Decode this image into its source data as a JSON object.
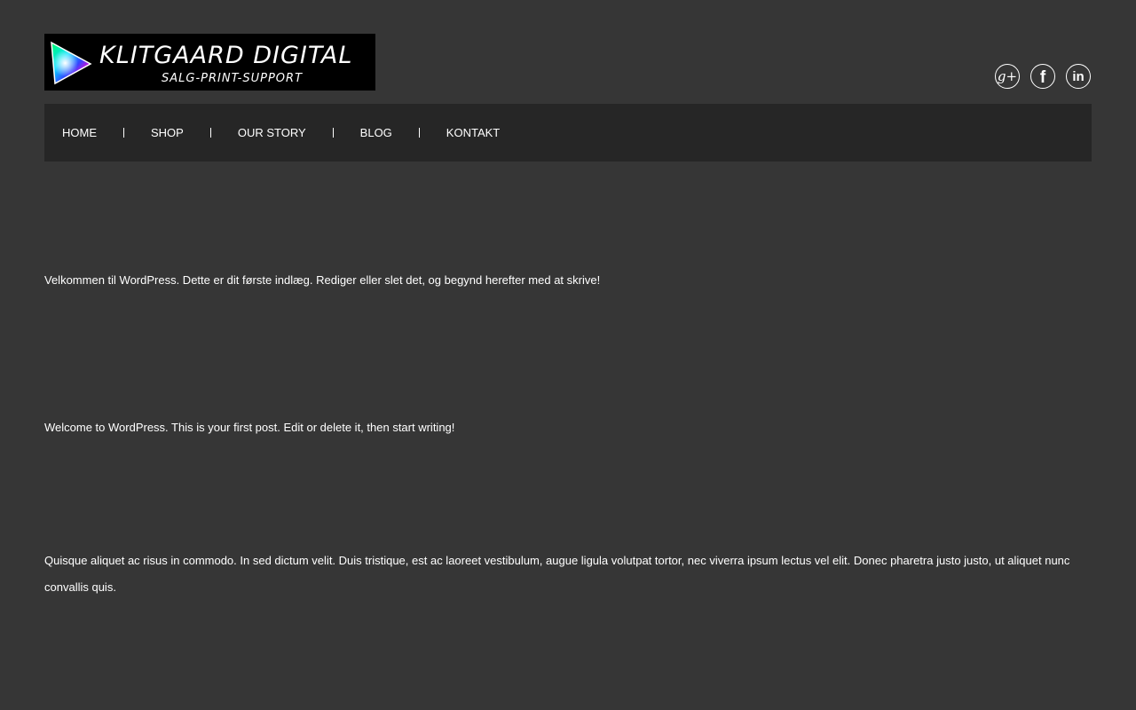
{
  "header": {
    "logo": {
      "title": "KLITGAARD DIGITAL",
      "subtitle": "SALG-PRINT-SUPPORT"
    },
    "social": [
      {
        "name": "google-plus-icon",
        "glyph": "g+"
      },
      {
        "name": "facebook-icon",
        "glyph": "f"
      },
      {
        "name": "linkedin-icon",
        "glyph": "in"
      }
    ]
  },
  "nav": {
    "items": [
      {
        "label": "HOME"
      },
      {
        "label": "SHOP"
      },
      {
        "label": "OUR STORY"
      },
      {
        "label": "BLOG"
      },
      {
        "label": "KONTAKT"
      }
    ]
  },
  "content": {
    "paragraphs": [
      {
        "text": "Velkommen til WordPress. Dette er dit første indlæg. Rediger eller slet det, og begynd herefter med at skrive!"
      },
      {
        "text": "Welcome to WordPress. This is your first post. Edit or delete it, then start writing!"
      },
      {
        "text": "Quisque aliquet ac risus in commodo. In sed dictum velit. Duis tristique, est ac laoreet vestibulum, augue ligula volutpat tortor, nec viverra ipsum lectus vel elit. Donec pharetra justo justo, ut aliquet nunc convallis quis."
      }
    ]
  },
  "colors": {
    "background": "#363636",
    "nav_background": "#262626",
    "text": "#ffffff",
    "logo_background": "#000000"
  }
}
